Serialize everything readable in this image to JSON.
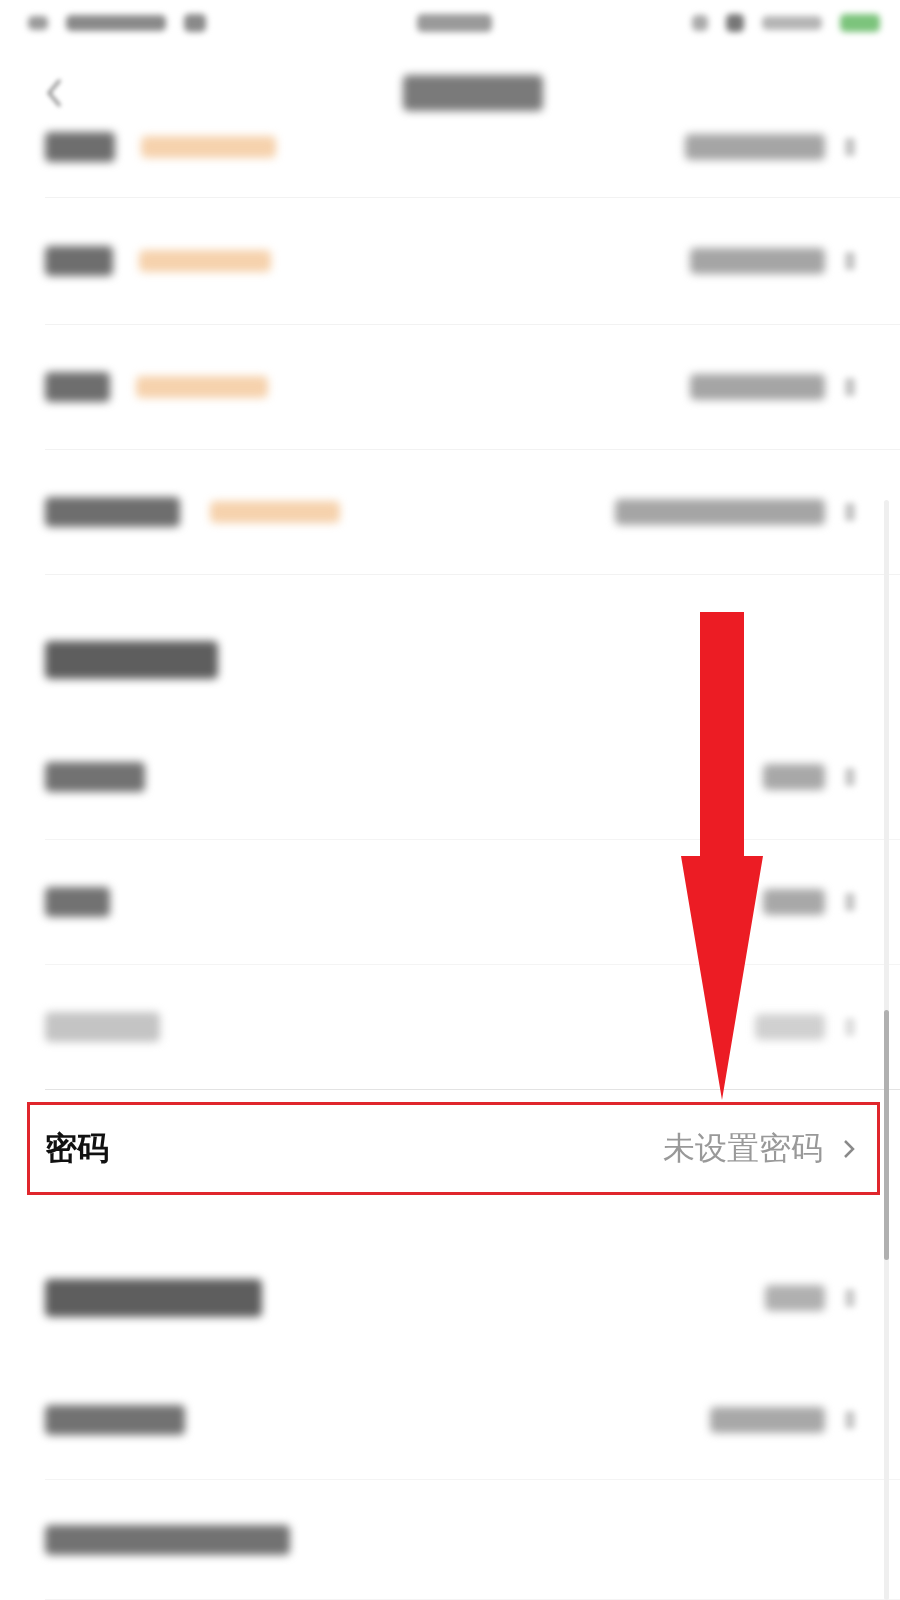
{
  "blurred_rows_above": [
    {
      "kind": "status_bar"
    },
    {
      "kind": "nav_bar"
    },
    {
      "kind": "tagged_row"
    },
    {
      "kind": "tagged_row"
    },
    {
      "kind": "tagged_row"
    },
    {
      "kind": "tagged_row"
    },
    {
      "kind": "section_heading"
    },
    {
      "kind": "row"
    },
    {
      "kind": "row"
    },
    {
      "kind": "faded_row"
    }
  ],
  "highlighted_row": {
    "label": "密码",
    "value": "未设置密码",
    "outlined": true,
    "arrow": true
  },
  "blurred_rows_below": [
    {
      "kind": "section_heading"
    },
    {
      "kind": "row"
    },
    {
      "kind": "row"
    }
  ]
}
